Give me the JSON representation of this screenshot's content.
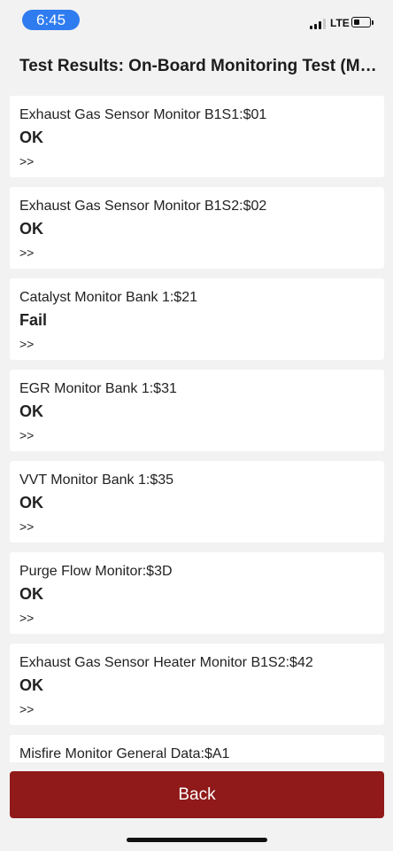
{
  "status_bar": {
    "time": "6:45",
    "network": "LTE",
    "battery_fraction": 0.38
  },
  "header": {
    "title": "Test Results: On-Board Monitoring Test (Mod..."
  },
  "results": [
    {
      "name": "Exhaust Gas Sensor Monitor B1S1:$01",
      "status": "OK",
      "more": ">>"
    },
    {
      "name": "Exhaust Gas Sensor Monitor B1S2:$02",
      "status": "OK",
      "more": ">>"
    },
    {
      "name": "Catalyst Monitor Bank 1:$21",
      "status": "Fail",
      "more": ">>"
    },
    {
      "name": "EGR Monitor Bank 1:$31",
      "status": "OK",
      "more": ">>"
    },
    {
      "name": "VVT Monitor Bank 1:$35",
      "status": "OK",
      "more": ">>"
    },
    {
      "name": "Purge Flow Monitor:$3D",
      "status": "OK",
      "more": ">>"
    },
    {
      "name": "Exhaust Gas Sensor Heater Monitor B1S2:$42",
      "status": "OK",
      "more": ">>"
    },
    {
      "name": "Misfire Monitor General Data:$A1",
      "status": "",
      "more": ""
    }
  ],
  "footer": {
    "back_label": "Back"
  },
  "colors": {
    "time_pill": "#2f7cf0",
    "back_button": "#8f1a19",
    "background": "#f2f2f2",
    "card": "#ffffff"
  }
}
